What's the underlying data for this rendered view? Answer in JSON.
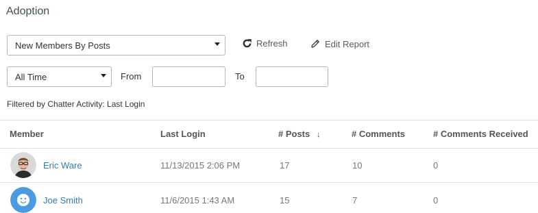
{
  "page": {
    "title": "Adoption"
  },
  "controls": {
    "report_select": {
      "selected": "New Members By Posts"
    },
    "refresh_label": "Refresh",
    "edit_report_label": "Edit Report",
    "range_select": {
      "selected": "All Time"
    },
    "from_label": "From",
    "from_value": "",
    "to_label": "To",
    "to_value": ""
  },
  "filter": {
    "text": "Filtered by Chatter Activity: Last Login"
  },
  "table": {
    "columns": [
      {
        "label": "Member"
      },
      {
        "label": "Last Login"
      },
      {
        "label": "# Posts",
        "sort_indicator": "↓"
      },
      {
        "label": "# Comments"
      },
      {
        "label": "# Comments Received"
      }
    ],
    "rows": [
      {
        "member": "Eric Ware",
        "avatar": "photo-avatar",
        "last_login": "11/13/2015 2:06 PM",
        "posts": "17",
        "comments": "10",
        "comments_received": "0"
      },
      {
        "member": "Joe Smith",
        "avatar": "smiley-avatar",
        "last_login": "11/6/2015 1:43 AM",
        "posts": "15",
        "comments": "7",
        "comments_received": "0"
      }
    ]
  },
  "colors": {
    "link": "#2f7ab8",
    "avatar_blue": "#4b9be0"
  }
}
